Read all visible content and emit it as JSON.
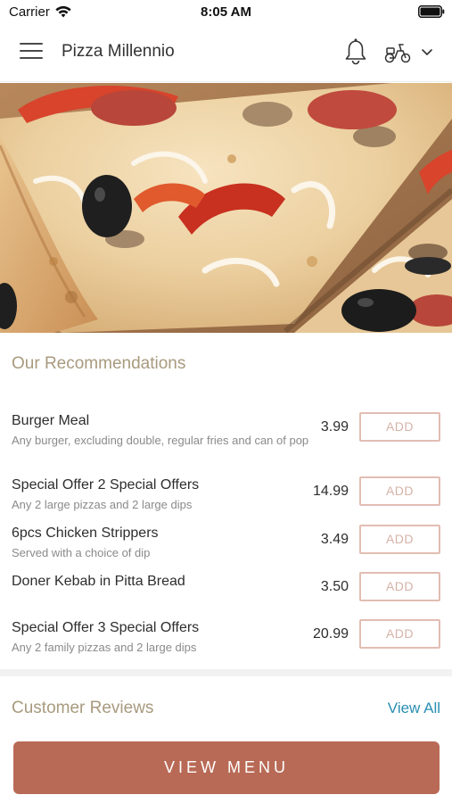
{
  "status_bar": {
    "carrier": "Carrier",
    "time": "8:05 AM",
    "wifi_icon": "wifi-icon",
    "battery_icon": "battery-icon"
  },
  "header": {
    "title": "Pizza Millennio",
    "menu_icon": "hamburger-menu-icon",
    "notification_icon": "bell-icon",
    "delivery_icon": "scooter-icon",
    "dropdown_icon": "chevron-down-icon"
  },
  "hero": {
    "image": "pizza-photo"
  },
  "recommendations": {
    "title": "Our Recommendations",
    "items": [
      {
        "name": "Burger Meal",
        "description": "Any burger, excluding double, regular fries and can of pop",
        "price": "3.99",
        "button": "ADD"
      },
      {
        "name": "Special Offer 2 Special Offers",
        "description": "Any 2 large pizzas and 2 large dips",
        "price": "14.99",
        "button": "ADD"
      },
      {
        "name": "6pcs Chicken Strippers",
        "description": "Served with a choice of dip",
        "price": "3.49",
        "button": "ADD"
      },
      {
        "name": "Doner Kebab in Pitta Bread",
        "description": "",
        "price": "3.50",
        "button": "ADD"
      },
      {
        "name": "Special Offer 3 Special Offers",
        "description": "Any 2 family pizzas and 2 large dips",
        "price": "20.99",
        "button": "ADD"
      }
    ]
  },
  "reviews": {
    "title": "Customer Reviews",
    "view_all": "View All"
  },
  "footer": {
    "view_menu": "VIEW MENU"
  },
  "colors": {
    "accent": "#b86a56",
    "section_title": "#a89a7e",
    "link": "#2a8fb3",
    "add_border": "#e2bdb3"
  }
}
